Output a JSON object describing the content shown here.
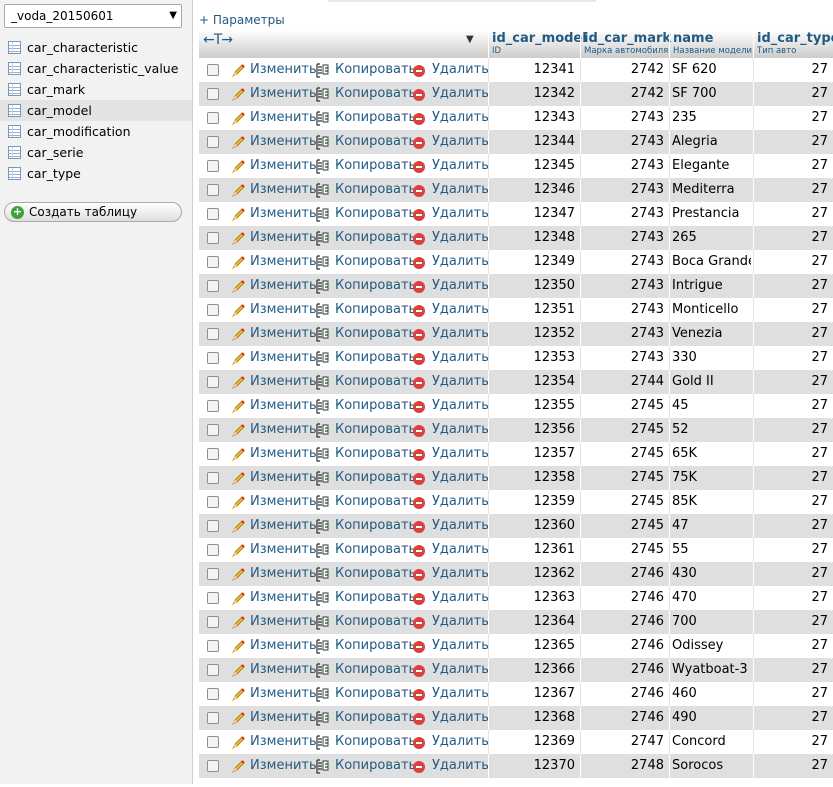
{
  "sidebar": {
    "database": "_voda_20150601",
    "tables": [
      {
        "label": "car_characteristic",
        "active": false
      },
      {
        "label": "car_characteristic_value",
        "active": false
      },
      {
        "label": "car_mark",
        "active": false
      },
      {
        "label": "car_model",
        "active": true
      },
      {
        "label": "car_modification",
        "active": false
      },
      {
        "label": "car_serie",
        "active": false
      },
      {
        "label": "car_type",
        "active": false
      }
    ],
    "create_table_label": "Создать таблицу"
  },
  "main": {
    "params_link": "+ Параметры",
    "resize_glyph": "←T→",
    "sort_glyph": "▼",
    "columns": [
      {
        "name": "id_car_model",
        "comment": "ID"
      },
      {
        "name": "id_car_mark",
        "comment": "Марка автомобиля"
      },
      {
        "name": "name",
        "comment": "Название модели"
      },
      {
        "name": "id_car_type",
        "comment": "Тип авто"
      }
    ],
    "actions": {
      "edit": "Изменить",
      "copy": "Копировать",
      "delete": "Удалить"
    },
    "rows": [
      {
        "id": "12341",
        "mark": "2742",
        "name": "SF 620",
        "type": "27"
      },
      {
        "id": "12342",
        "mark": "2742",
        "name": "SF 700",
        "type": "27"
      },
      {
        "id": "12343",
        "mark": "2743",
        "name": "235",
        "type": "27"
      },
      {
        "id": "12344",
        "mark": "2743",
        "name": "Alegria",
        "type": "27"
      },
      {
        "id": "12345",
        "mark": "2743",
        "name": "Elegante",
        "type": "27"
      },
      {
        "id": "12346",
        "mark": "2743",
        "name": "Mediterra",
        "type": "27"
      },
      {
        "id": "12347",
        "mark": "2743",
        "name": "Prestancia",
        "type": "27"
      },
      {
        "id": "12348",
        "mark": "2743",
        "name": "265",
        "type": "27"
      },
      {
        "id": "12349",
        "mark": "2743",
        "name": "Boca Grande",
        "type": "27"
      },
      {
        "id": "12350",
        "mark": "2743",
        "name": "Intrigue",
        "type": "27"
      },
      {
        "id": "12351",
        "mark": "2743",
        "name": "Monticello",
        "type": "27"
      },
      {
        "id": "12352",
        "mark": "2743",
        "name": "Venezia",
        "type": "27"
      },
      {
        "id": "12353",
        "mark": "2743",
        "name": "330",
        "type": "27"
      },
      {
        "id": "12354",
        "mark": "2744",
        "name": "Gold II",
        "type": "27"
      },
      {
        "id": "12355",
        "mark": "2745",
        "name": "45",
        "type": "27"
      },
      {
        "id": "12356",
        "mark": "2745",
        "name": "52",
        "type": "27"
      },
      {
        "id": "12357",
        "mark": "2745",
        "name": "65K",
        "type": "27"
      },
      {
        "id": "12358",
        "mark": "2745",
        "name": "75K",
        "type": "27"
      },
      {
        "id": "12359",
        "mark": "2745",
        "name": "85K",
        "type": "27"
      },
      {
        "id": "12360",
        "mark": "2745",
        "name": "47",
        "type": "27"
      },
      {
        "id": "12361",
        "mark": "2745",
        "name": "55",
        "type": "27"
      },
      {
        "id": "12362",
        "mark": "2746",
        "name": "430",
        "type": "27"
      },
      {
        "id": "12363",
        "mark": "2746",
        "name": "470",
        "type": "27"
      },
      {
        "id": "12364",
        "mark": "2746",
        "name": "700",
        "type": "27"
      },
      {
        "id": "12365",
        "mark": "2746",
        "name": "Odissey",
        "type": "27"
      },
      {
        "id": "12366",
        "mark": "2746",
        "name": "Wyatboat-3",
        "type": "27"
      },
      {
        "id": "12367",
        "mark": "2746",
        "name": "460",
        "type": "27"
      },
      {
        "id": "12368",
        "mark": "2746",
        "name": "490",
        "type": "27"
      },
      {
        "id": "12369",
        "mark": "2747",
        "name": "Concord",
        "type": "27"
      },
      {
        "id": "12370",
        "mark": "2748",
        "name": "Sorocos",
        "type": "27"
      }
    ]
  },
  "colors": {
    "link": "#235a81",
    "row_even": "#dfdfdf",
    "delete": "#d8443c",
    "create_plus": "#3fa23a"
  }
}
